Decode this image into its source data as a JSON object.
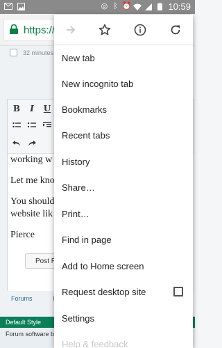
{
  "status_bar": {
    "time": "10:59",
    "left_icons": [
      "email-icon",
      "image-icon"
    ],
    "right_icons": [
      "data-saver-icon",
      "bluetooth-icon",
      "alarm-icon",
      "wifi-icon",
      "signal-icon",
      "battery-icon"
    ]
  },
  "url_bar": {
    "url_text": "https://v"
  },
  "page": {
    "post_meta": "32 minutes",
    "toolbar_row1": [
      "B",
      "I",
      "U"
    ],
    "editor_lines": [
      "working w",
      "Let me kno",
      "You should",
      "website lik",
      "Pierce"
    ],
    "post_button": "Post R",
    "breadcrumbs": [
      "Forums",
      "Ne"
    ],
    "footer_green": "Default Style",
    "footer_soft": "Forum software by"
  },
  "menu": {
    "top_icons": [
      "forward-icon",
      "bookmark-star-icon",
      "info-icon",
      "refresh-icon"
    ],
    "items": [
      {
        "label": "New tab"
      },
      {
        "label": "New incognito tab"
      },
      {
        "label": "Bookmarks"
      },
      {
        "label": "Recent tabs"
      },
      {
        "label": "History"
      },
      {
        "label": "Share…"
      },
      {
        "label": "Print…"
      },
      {
        "label": "Find in page"
      },
      {
        "label": "Add to Home screen"
      },
      {
        "label": "Request desktop site"
      },
      {
        "label": "Settings"
      },
      {
        "label": "Help & feedback"
      }
    ]
  },
  "colors": {
    "url_green": "#0b8043",
    "status_bar": "#8a8a8a",
    "footer_green": "#0b7f58",
    "disabled_icon": "#c8c8c8"
  }
}
